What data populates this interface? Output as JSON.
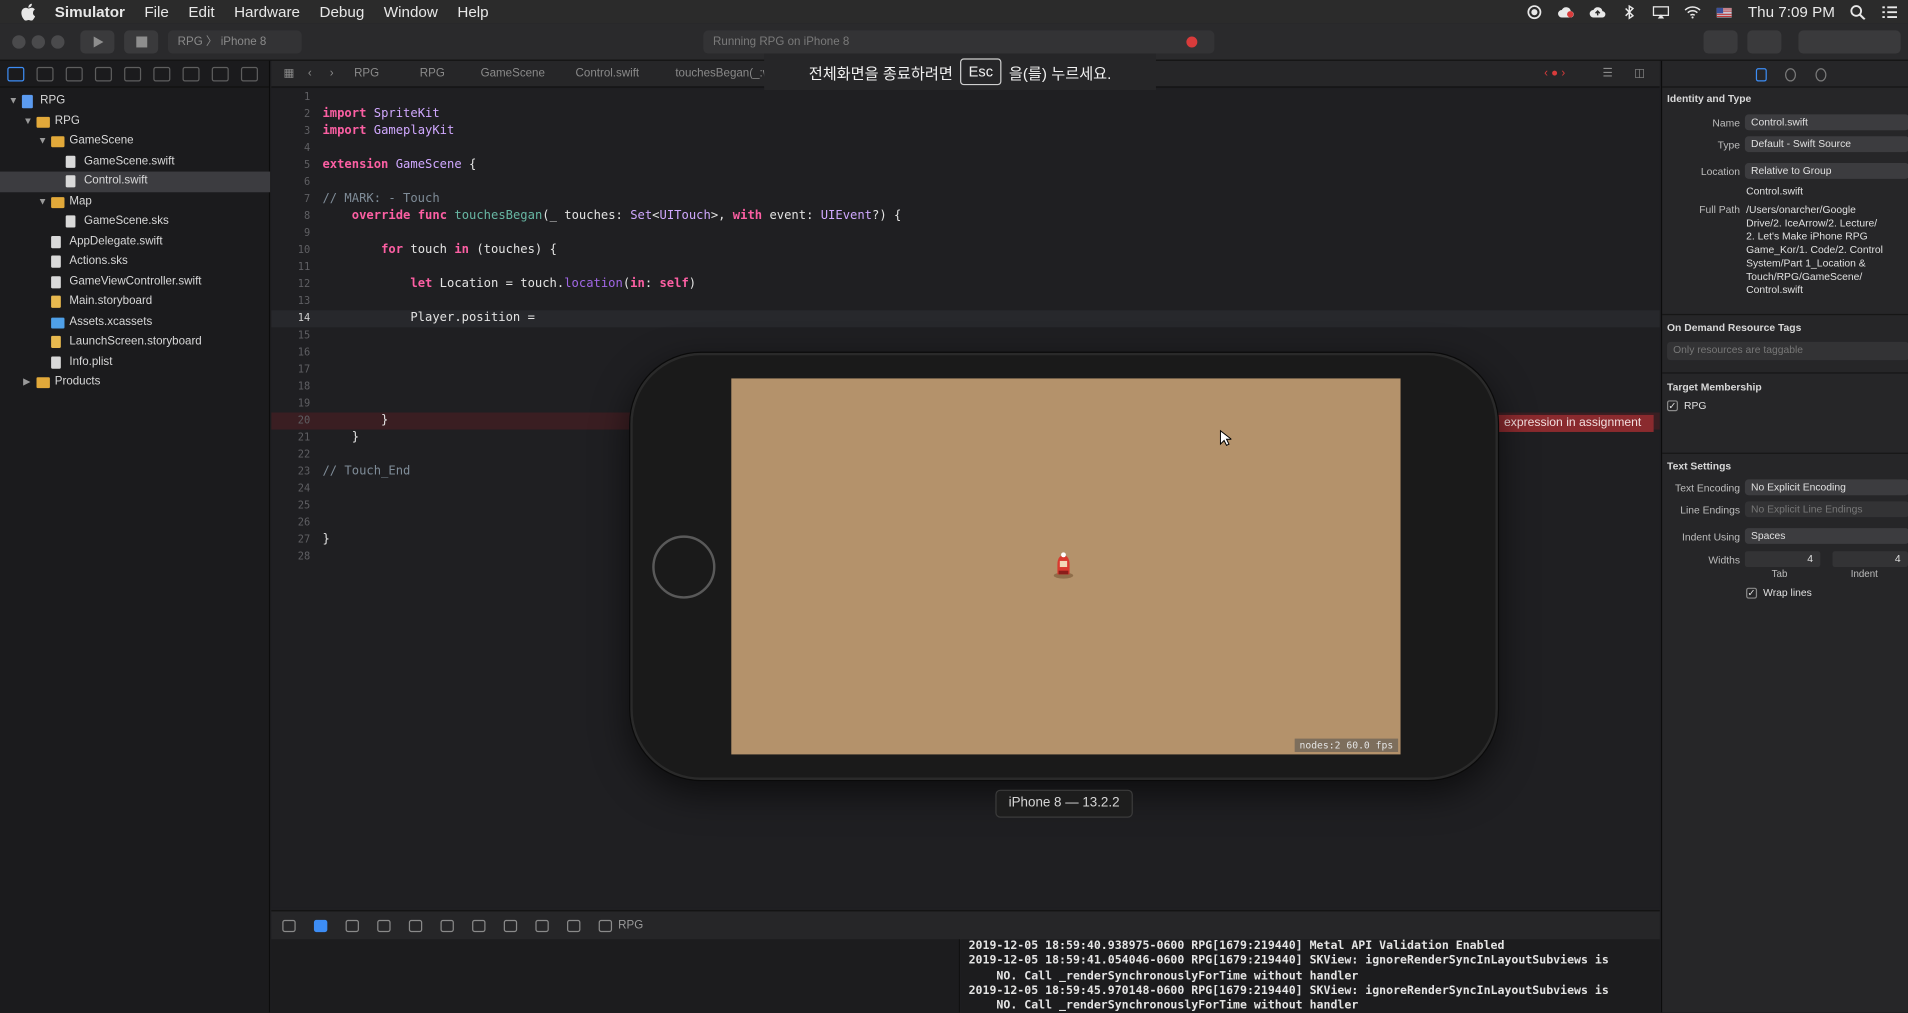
{
  "menubar": {
    "app_name": "Simulator",
    "items": [
      "File",
      "Edit",
      "Hardware",
      "Debug",
      "Window",
      "Help"
    ],
    "clock": "Thu 7:09 PM",
    "icons": [
      "record-icon",
      "creative-cloud-icon",
      "cloud-upload-icon",
      "bluetooth-icon",
      "airplay-icon",
      "wifi-icon",
      "flag-icon",
      "search-icon",
      "list-icon"
    ]
  },
  "toolbar": {
    "scheme": "RPG",
    "device": "iPhone 8",
    "activity_text": "Running RPG on iPhone 8",
    "error_count": "1"
  },
  "fullscreen_banner": {
    "text_before": "전체화면을 종료하려면",
    "key": "Esc",
    "text_after": "을(를) 누르세요."
  },
  "navigator": {
    "tree": [
      {
        "label": "RPG",
        "kind": "proj",
        "depth": 0,
        "disc": "▼"
      },
      {
        "label": "RPG",
        "kind": "folder",
        "depth": 1,
        "disc": "▼"
      },
      {
        "label": "GameScene",
        "kind": "folder",
        "depth": 2,
        "disc": "▼"
      },
      {
        "label": "GameScene.swift",
        "kind": "file",
        "depth": 3,
        "disc": ""
      },
      {
        "label": "Control.swift",
        "kind": "file",
        "depth": 3,
        "disc": "",
        "selected": true
      },
      {
        "label": "Map",
        "kind": "folder",
        "depth": 2,
        "disc": "▼"
      },
      {
        "label": "GameScene.sks",
        "kind": "file",
        "depth": 3,
        "disc": ""
      },
      {
        "label": "AppDelegate.swift",
        "kind": "file",
        "depth": 2,
        "disc": ""
      },
      {
        "label": "Actions.sks",
        "kind": "file",
        "depth": 2,
        "disc": ""
      },
      {
        "label": "GameViewController.swift",
        "kind": "file",
        "depth": 2,
        "disc": ""
      },
      {
        "label": "Main.storyboard",
        "kind": "sb",
        "depth": 2,
        "disc": ""
      },
      {
        "label": "Assets.xcassets",
        "kind": "assets",
        "depth": 2,
        "disc": ""
      },
      {
        "label": "LaunchScreen.storyboard",
        "kind": "sb",
        "depth": 2,
        "disc": ""
      },
      {
        "label": "Info.plist",
        "kind": "file",
        "depth": 2,
        "disc": ""
      },
      {
        "label": "Products",
        "kind": "folder",
        "depth": 1,
        "disc": "▶"
      }
    ]
  },
  "jumpbar": {
    "crumbs": [
      "RPG",
      "RPG",
      "GameScene",
      "Control.swift",
      "touchesBegan(_:with:)"
    ]
  },
  "editor": {
    "current_line": 14,
    "error_line": 20,
    "error_message": "expression in assignment",
    "lines": [
      {
        "n": "1",
        "t": ""
      },
      {
        "n": "2",
        "t": "import SpriteKit"
      },
      {
        "n": "3",
        "t": "import GameplayKit"
      },
      {
        "n": "4",
        "t": ""
      },
      {
        "n": "5",
        "t": "extension GameScene {"
      },
      {
        "n": "6",
        "t": ""
      },
      {
        "n": "7",
        "t": "// MARK: - Touch"
      },
      {
        "n": "8",
        "t": "    override func touchesBegan(_ touches: Set<UITouch>, with event: UIEvent?) {"
      },
      {
        "n": "9",
        "t": ""
      },
      {
        "n": "10",
        "t": "        for touch in (touches) {"
      },
      {
        "n": "11",
        "t": ""
      },
      {
        "n": "12",
        "t": "            let Location = touch.location(in: self)"
      },
      {
        "n": "13",
        "t": ""
      },
      {
        "n": "14",
        "t": "            Player.position = "
      },
      {
        "n": "15",
        "t": ""
      },
      {
        "n": "16",
        "t": ""
      },
      {
        "n": "17",
        "t": ""
      },
      {
        "n": "18",
        "t": ""
      },
      {
        "n": "19",
        "t": ""
      },
      {
        "n": "20",
        "t": "        }"
      },
      {
        "n": "21",
        "t": "    }"
      },
      {
        "n": "22",
        "t": ""
      },
      {
        "n": "23",
        "t": "// Touch_End"
      },
      {
        "n": "24",
        "t": ""
      },
      {
        "n": "25",
        "t": ""
      },
      {
        "n": "26",
        "t": ""
      },
      {
        "n": "27",
        "t": "}"
      },
      {
        "n": "28",
        "t": ""
      }
    ]
  },
  "simulator": {
    "device_label": "iPhone 8 — 13.2.2",
    "stats": "nodes:2  60.0 fps",
    "scene_color": "#b4926b"
  },
  "debugbar": {
    "target": "RPG"
  },
  "console": {
    "lines": [
      "2019-12-05 18:59:40.938975-0600 RPG[1679:219440] Metal API Validation Enabled",
      "2019-12-05 18:59:41.054046-0600 RPG[1679:219440] SKView: ignoreRenderSyncInLayoutSubviews is",
      "    NO. Call _renderSynchronouslyForTime without handler",
      "2019-12-05 18:59:45.970148-0600 RPG[1679:219440] SKView: ignoreRenderSyncInLayoutSubviews is",
      "    NO. Call _renderSynchronouslyForTime without handler"
    ]
  },
  "inspector": {
    "identity_title": "Identity and Type",
    "name_label": "Name",
    "name_value": "Control.swift",
    "type_label": "Type",
    "type_value": "Default - Swift Source",
    "location_label": "Location",
    "location_value": "Relative to Group",
    "location_file": "Control.swift",
    "fullpath_label": "Full Path",
    "fullpath_lines": [
      "/Users/onarcher/Google",
      "Drive/2. IceArrow/2. Lecture/",
      "2. Let's Make iPhone RPG",
      "Game_Kor/1. Code/2. Control",
      "System/Part 1_Location &",
      "Touch/RPG/GameScene/",
      "Control.swift"
    ],
    "odr_title": "On Demand Resource Tags",
    "odr_placeholder": "Only resources are taggable",
    "target_title": "Target Membership",
    "target_name": "RPG",
    "text_title": "Text Settings",
    "encoding_label": "Text Encoding",
    "encoding_value": "No Explicit Encoding",
    "endings_label": "Line Endings",
    "endings_value": "No Explicit Line Endings",
    "indent_label": "Indent Using",
    "indent_value": "Spaces",
    "widths_label": "Widths",
    "tab_value": "4",
    "indent_value_num": "4",
    "tab_caption": "Tab",
    "indent_caption": "Indent",
    "wrap_label": "Wrap lines"
  }
}
